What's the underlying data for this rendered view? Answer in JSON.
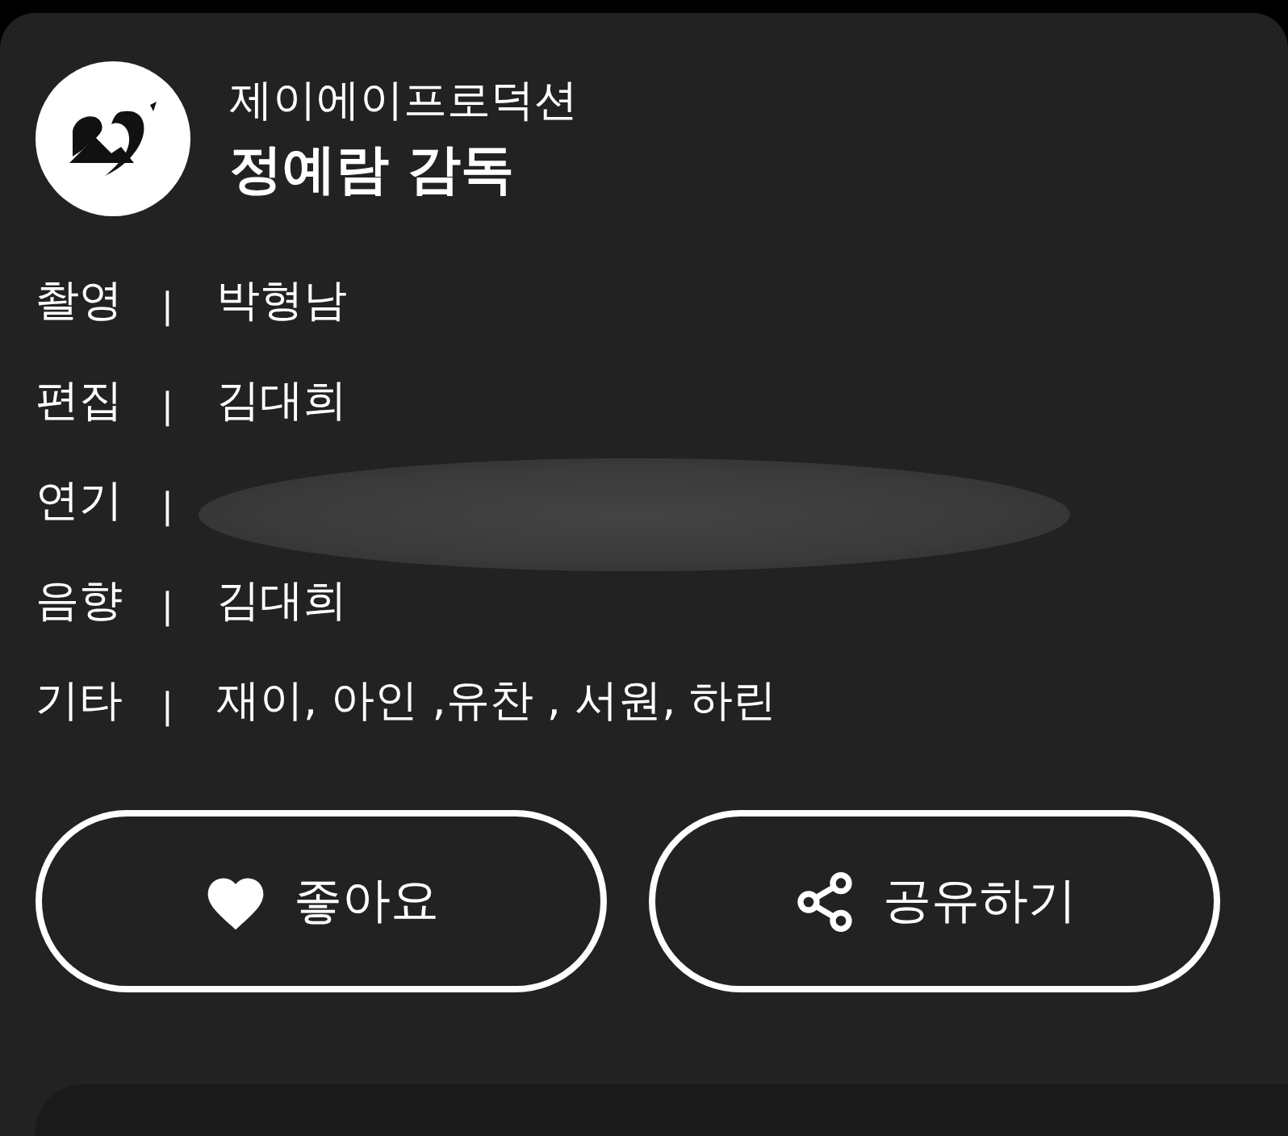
{
  "header": {
    "company": "제이에이프로덕션",
    "director": "정예람 감독"
  },
  "credits": [
    {
      "label": "촬영",
      "separator": "|",
      "value": "박형남",
      "redacted": false
    },
    {
      "label": "편집",
      "separator": "|",
      "value": "김대희",
      "redacted": false
    },
    {
      "label": "연기",
      "separator": "|",
      "redacted": true
    },
    {
      "label": "음향",
      "separator": "|",
      "value": "김대희",
      "redacted": false
    },
    {
      "label": "기타",
      "separator": "|",
      "value": "재이, 아인 ,유찬 , 서원, 하린",
      "redacted": false
    }
  ],
  "buttons": [
    {
      "kind": "like",
      "label": "좋아요"
    },
    {
      "kind": "share",
      "label": "공유하기"
    }
  ]
}
